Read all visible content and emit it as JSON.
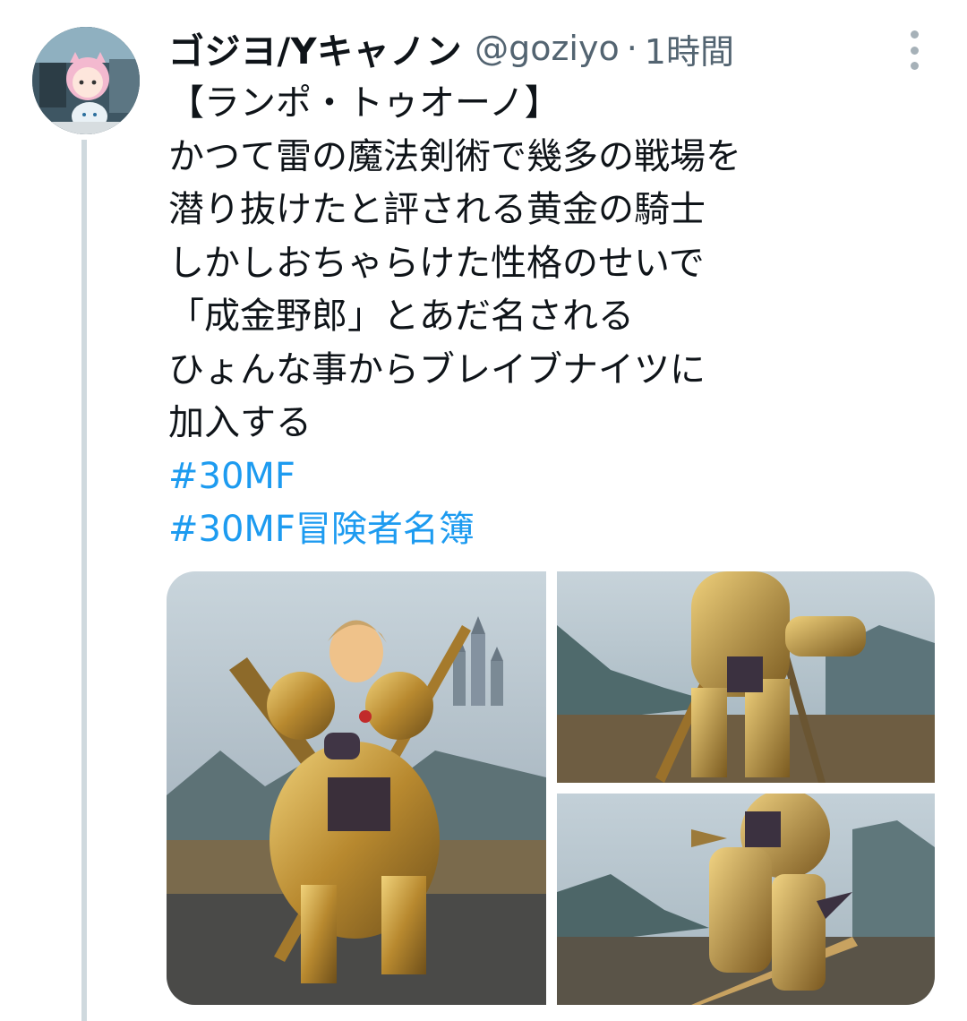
{
  "tweet": {
    "author": {
      "display_name": "ゴジヨ/Yキャノン",
      "handle": "@goziyo",
      "avatar_icon": "avatar-icon"
    },
    "separator": "·",
    "timestamp": "1時間",
    "menu_icon": "more-vertical-icon",
    "body_lines": [
      "【ランポ・トゥオーノ】",
      "かつて雷の魔法剣術で幾多の戦場を",
      "潜り抜けたと評される黄金の騎士",
      "しかしおちゃらけた性格のせいで",
      "「成金野郎」とあだ名される",
      "ひょんな事からブレイブナイツに",
      "加入する"
    ],
    "hashtags": [
      "#30MF",
      "#30MF冒険者名簿"
    ],
    "colors": {
      "link": "#1d9bf0",
      "secondary_text": "#536471",
      "thread_line": "#cfd9de"
    }
  }
}
